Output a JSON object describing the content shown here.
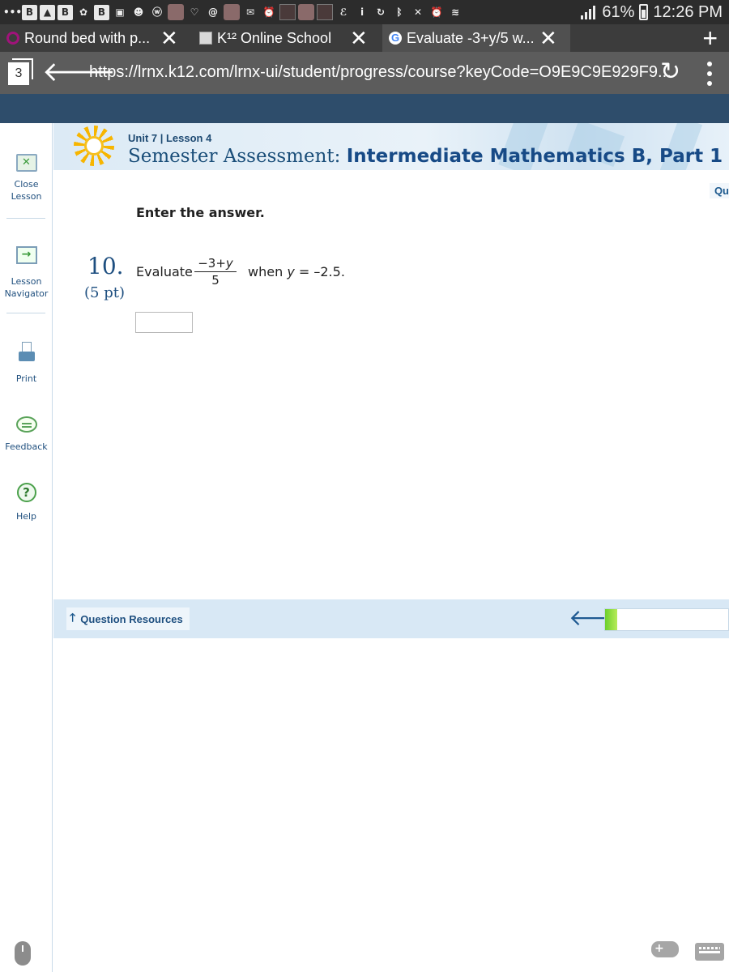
{
  "status_bar": {
    "battery": "61%",
    "time": "12:26 PM",
    "notification_icons": [
      "more-dots-icon",
      "b-app-icon",
      "gallery-icon",
      "b-app-icon",
      "flower-app-icon",
      "b-app-icon",
      "photo-icon",
      "smiley-icon",
      "w-app-icon",
      "game-app-icon",
      "heart-app-icon",
      "snail-app-icon",
      "avatar-app-icon",
      "mail-icon",
      "alarm-icon",
      "app-icon",
      "avatar-app-icon",
      "app-icon",
      "e-app-icon",
      "info-icon",
      "sync-icon",
      "bluetooth-icon",
      "mute-icon",
      "alarm-icon",
      "wifi-icon",
      "signal-icon"
    ]
  },
  "tabs": [
    {
      "title": "Round bed with p...",
      "close": "✕"
    },
    {
      "title": "K¹² Online School",
      "close": "✕"
    },
    {
      "title": "Evaluate -3+y/5 w...",
      "close": "✕"
    }
  ],
  "new_tab_label": "+",
  "address_bar": {
    "tab_count": "3",
    "url": "https://lrnx.k12.com/lrnx-ui/student/progress/course?keyCode=O9E9C9E929F9..."
  },
  "rail": {
    "close_label_1": "Close",
    "close_label_2": "Lesson",
    "navigator_label_1": "Lesson",
    "navigator_label_2": "Navigator",
    "print_label": "Print",
    "feedback_label": "Feedback",
    "help_label": "Help"
  },
  "lesson": {
    "unit_line": "Unit 7 | Lesson 4",
    "title_prefix": "Semester Assessment:",
    "title_course": "Intermediate Mathematics B, Part 1",
    "side_tab": "Qu"
  },
  "question": {
    "instruction": "Enter the answer.",
    "number": "10.",
    "points": "(5 pt)",
    "verb": "Evaluate",
    "numerator_prefix": "−3+",
    "numerator_var": "y",
    "denominator": "5",
    "when_prefix": "when",
    "when_var": "y",
    "when_value": "= –2.5.",
    "answer_value": ""
  },
  "footer": {
    "resources_label": "Question Resources",
    "progress": 0.1
  },
  "colors": {
    "page_header": "#2e4d6b",
    "accent_blue": "#1e4f80",
    "footer_bg": "#d8e8f5",
    "progress_green": "#6ccf2c"
  }
}
